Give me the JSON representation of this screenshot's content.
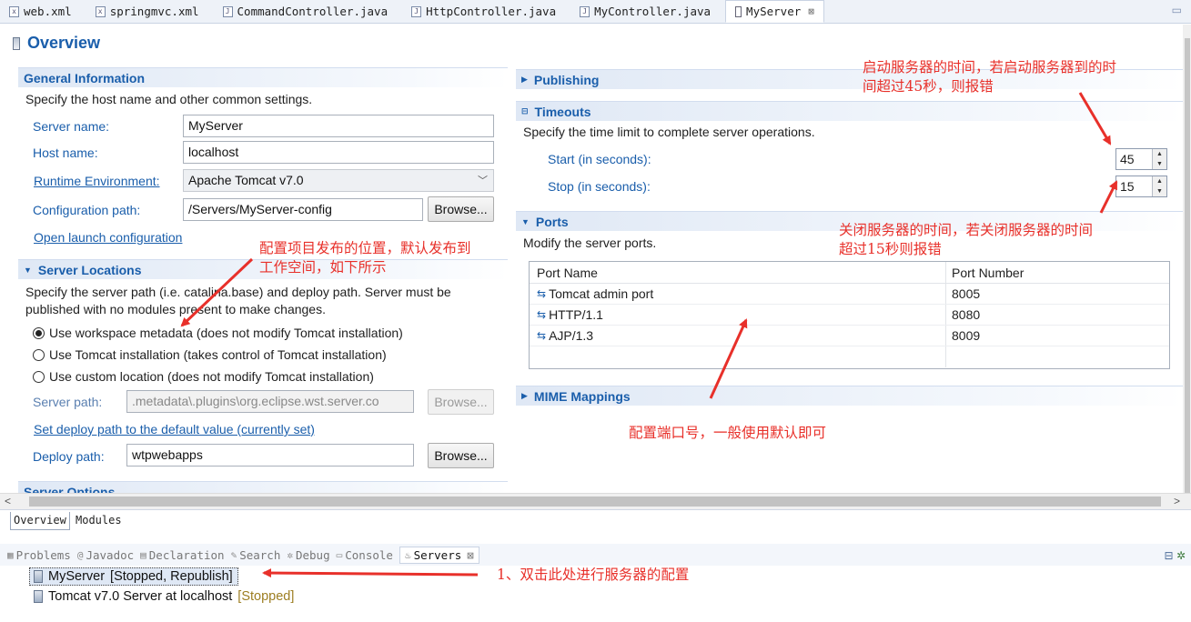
{
  "editor_tabs": [
    {
      "label": "web.xml",
      "icon": "xml-file-icon"
    },
    {
      "label": "springmvc.xml",
      "icon": "xml-file-icon"
    },
    {
      "label": "CommandController.java",
      "icon": "java-file-icon"
    },
    {
      "label": "HttpController.java",
      "icon": "java-file-icon"
    },
    {
      "label": "MyController.java",
      "icon": "java-file-icon"
    },
    {
      "label": "MyServer",
      "icon": "server-icon",
      "active": true,
      "close": "⊠"
    }
  ],
  "page": {
    "title": "Overview"
  },
  "general": {
    "heading": "General Information",
    "description": "Specify the host name and other common settings.",
    "server_name_label": "Server name:",
    "server_name": "MyServer",
    "host_name_label": "Host name:",
    "host_name": "localhost",
    "runtime_label": "Runtime Environment:",
    "runtime": "Apache Tomcat v7.0",
    "config_path_label": "Configuration path:",
    "config_path": "/Servers/MyServer-config",
    "browse": "Browse...",
    "open_launch": "Open launch configuration"
  },
  "locations": {
    "heading": "Server Locations",
    "description": "Specify the server path (i.e. catalina.base) and deploy path. Server must be published with no modules present to make changes.",
    "options": [
      {
        "label": "Use workspace metadata (does not modify Tomcat installation)",
        "selected": true
      },
      {
        "label": "Use Tomcat installation (takes control of Tomcat installation)",
        "selected": false
      },
      {
        "label": "Use custom location (does not modify Tomcat installation)",
        "selected": false
      }
    ],
    "server_path_label": "Server path:",
    "server_path": ".metadata\\.plugins\\org.eclipse.wst.server.co",
    "browse": "Browse...",
    "set_deploy_link": "Set deploy path to the default value (currently set)",
    "deploy_path_label": "Deploy path:",
    "deploy_path": "wtpwebapps",
    "next_heading_partial": "Server Options"
  },
  "publishing": {
    "heading": "Publishing"
  },
  "timeouts": {
    "heading": "Timeouts",
    "description": "Specify the time limit to complete server operations.",
    "start_label": "Start (in seconds):",
    "start_value": "45",
    "stop_label": "Stop (in seconds):",
    "stop_value": "15"
  },
  "ports": {
    "heading": "Ports",
    "description": "Modify the server ports.",
    "columns": [
      "Port Name",
      "Port Number"
    ],
    "rows": [
      {
        "name": "Tomcat admin port",
        "number": "8005"
      },
      {
        "name": "HTTP/1.1",
        "number": "8080"
      },
      {
        "name": "AJP/1.3",
        "number": "8009"
      }
    ]
  },
  "mime": {
    "heading": "MIME Mappings"
  },
  "page_tabs": [
    "Overview",
    "Modules"
  ],
  "views": {
    "tabs": [
      {
        "label": "Problems",
        "icon": "problems-icon"
      },
      {
        "label": "Javadoc",
        "icon": "javadoc-icon"
      },
      {
        "label": "Declaration",
        "icon": "declaration-icon"
      },
      {
        "label": "Search",
        "icon": "search-icon"
      },
      {
        "label": "Debug",
        "icon": "debug-icon"
      },
      {
        "label": "Console",
        "icon": "console-icon"
      },
      {
        "label": "Servers",
        "icon": "servers-icon",
        "active": true,
        "close": "⊠"
      }
    ],
    "servers": [
      {
        "name": "MyServer",
        "state": "[Stopped, Republish]"
      },
      {
        "name": "Tomcat v7.0 Server at localhost",
        "state": "[Stopped]"
      }
    ]
  },
  "annotations": {
    "timeout_start": "启动服务器的时间，若启动服务器到的时间超过45秒，则报错",
    "timeout_start_l1": "启动服务器的时间，若启动服务器到的时",
    "timeout_start_l2": "间超过45秒，则报错",
    "timeout_stop_l1": "关闭服务器的时间，若关闭服务器的时间",
    "timeout_stop_l2": "超过15秒则报错",
    "deploy_l1": "配置项目发布的位置，默认发布到",
    "deploy_l2": "工作空间，如下所示",
    "ports_note": "配置端口号，一般使用默认即可",
    "servers_note": "1、双击此处进行服务器的配置",
    "color": "#e8302a"
  }
}
